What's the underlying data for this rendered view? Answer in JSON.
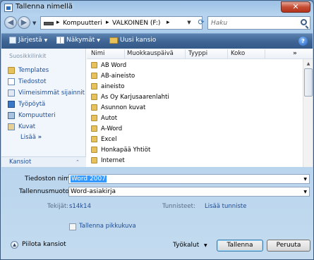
{
  "window": {
    "title": "Tallenna nimellä",
    "close_symbol": "✕"
  },
  "navigation": {
    "back_symbol": "◀",
    "forward_symbol": "▶",
    "address": [
      "Kompuutteri",
      "VALKOINEN (F:)"
    ],
    "search_placeholder": "Haku"
  },
  "toolbar": {
    "organize": "Järjestä",
    "views": "Näkymät",
    "new_folder": "Uusi kansio",
    "help": "?"
  },
  "sidebar": {
    "heading": "Suosikkilinkit",
    "items": [
      {
        "label": "Templates",
        "icon": "folder-icon"
      },
      {
        "label": "Tiedostot",
        "icon": "documents-icon"
      },
      {
        "label": "Viimeisimmät sijainnit",
        "icon": "recent-places-icon"
      },
      {
        "label": "Työpöytä",
        "icon": "desktop-icon"
      },
      {
        "label": "Kompuutteri",
        "icon": "computer-icon"
      },
      {
        "label": "Kuvat",
        "icon": "pictures-icon"
      }
    ],
    "more": "Lisää",
    "more_arrows": "»",
    "folders": "Kansiot",
    "folders_chevron": "⌃"
  },
  "file_list": {
    "columns": [
      "Nimi",
      "Muokkauspäivä",
      "Tyyppi",
      "Koko"
    ],
    "more_columns": "»",
    "rows": [
      "AB Word",
      "AB-aineisto",
      "aineisto",
      "As Oy Karjusaarenlahti",
      "Asunnon kuvat",
      "Autot",
      "A-Word",
      "Excel",
      "Honkapää Yhtiöt",
      "Internet"
    ]
  },
  "form": {
    "filename_label": "Tiedoston nimi:",
    "filename_value": "Word 2007",
    "format_label": "Tallennusmuoto:",
    "format_value": "Word-asiakirja",
    "authors_label": "Tekijät:",
    "authors_value": "s14k14",
    "tags_label": "Tunnisteet:",
    "tags_value": "Lisää tunniste",
    "thumbnail_label": "Tallenna pikkukuva"
  },
  "footer": {
    "hide_folders": "Piilota kansiot",
    "tools": "Työkalut",
    "save": "Tallenna",
    "cancel": "Peruuta"
  }
}
